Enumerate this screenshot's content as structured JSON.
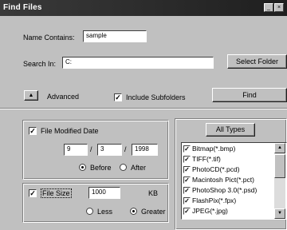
{
  "window": {
    "title": "Find Files",
    "minimize_glyph": "_",
    "close_glyph": "×"
  },
  "name_contains": {
    "label": "Name Contains:",
    "value": "sample"
  },
  "search_in": {
    "label": "Search In:",
    "value": "C:",
    "select_folder_label": "Select Folder"
  },
  "advanced": {
    "label": "Advanced",
    "toggle_glyph": "▲"
  },
  "include_subfolders": {
    "label": "Include Subfolders",
    "checked": true
  },
  "find_label": "Find",
  "date_group": {
    "label": "File Modified Date",
    "checked": true,
    "month": "9",
    "day": "3",
    "year": "1998",
    "separator": "/",
    "before_label": "Before",
    "after_label": "After",
    "selected": "Before"
  },
  "size_group": {
    "label": "File Size",
    "checked": true,
    "value": "1000",
    "unit": "KB",
    "less_label": "Less",
    "greater_label": "Greater",
    "selected": "Greater"
  },
  "types": {
    "all_types_label": "All Types",
    "items": [
      {
        "label": "Bitmap(*.bmp)",
        "checked": true
      },
      {
        "label": "TIFF(*.tif)",
        "checked": true
      },
      {
        "label": "PhotoCD(*.pcd)",
        "checked": true
      },
      {
        "label": "Macintosh Pict(*.pct)",
        "checked": true
      },
      {
        "label": "PhotoShop 3.0(*.psd)",
        "checked": true
      },
      {
        "label": "FlashPix(*.fpx)",
        "checked": true
      },
      {
        "label": "JPEG(*.jpg)",
        "checked": true
      }
    ]
  },
  "check_glyph": "✓",
  "icons": {
    "scroll_up": "▲",
    "scroll_down": "▼"
  }
}
